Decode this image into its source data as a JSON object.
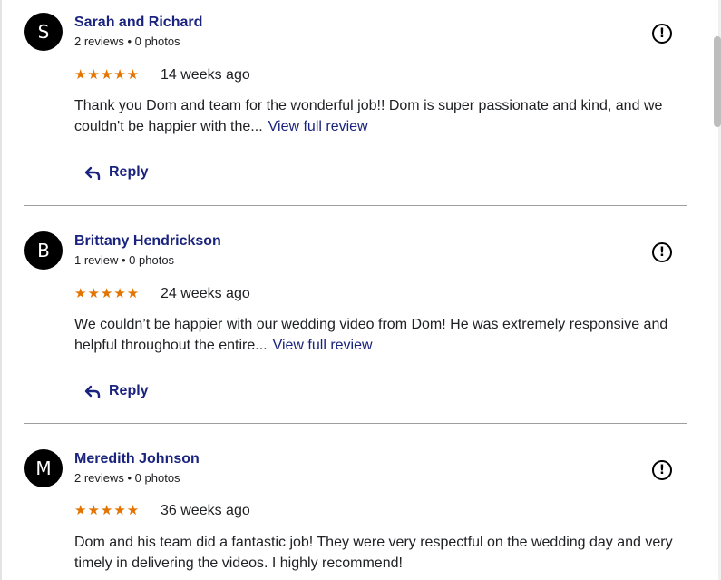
{
  "reviews": [
    {
      "avatar_letter": "S",
      "name": "Sarah and Richard",
      "meta": "2 reviews • 0 photos",
      "stars": "★★★★★",
      "date": "14 weeks ago",
      "text": "Thank you Dom and team for the wonderful job!! Dom is super passionate and kind, and we couldn't be happier with the...",
      "view_full": "View full review",
      "reply": "Reply",
      "report_icon": "report-icon"
    },
    {
      "avatar_letter": "B",
      "name": "Brittany Hendrickson",
      "meta": "1 review • 0 photos",
      "stars": "★★★★★",
      "date": "24 weeks ago",
      "text": "We couldn’t be happier with our wedding video from Dom! He was extremely responsive and helpful throughout the entire...",
      "view_full": "View full review",
      "reply": "Reply",
      "report_icon": "report-icon"
    },
    {
      "avatar_letter": "M",
      "name": "Meredith Johnson",
      "meta": "2 reviews • 0 photos",
      "stars": "★★★★★",
      "date": "36 weeks ago",
      "text": "Dom and his team did a fantastic job! They were very respectful on the wedding day and very timely in delivering the videos. I highly recommend!",
      "report_icon": "report-icon"
    }
  ],
  "rating": 5,
  "colors": {
    "name": "#1a237e",
    "stars": "#e37400",
    "link": "#1a237e",
    "avatar_bg": "#000000"
  }
}
